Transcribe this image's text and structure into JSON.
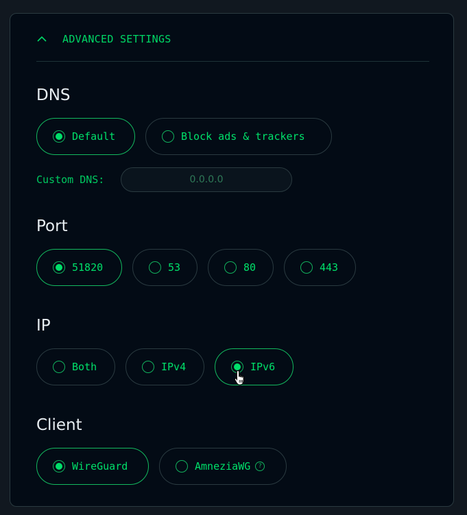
{
  "header": {
    "title": "ADVANCED SETTINGS",
    "toggle_icon": "chevron-up-icon"
  },
  "dns": {
    "title": "DNS",
    "options": [
      {
        "label": "Default",
        "selected": true
      },
      {
        "label": "Block ads & trackers",
        "selected": false
      }
    ],
    "custom_label": "Custom DNS:",
    "custom_placeholder": "0.0.0.0",
    "custom_value": ""
  },
  "port": {
    "title": "Port",
    "options": [
      {
        "label": "51820",
        "selected": true
      },
      {
        "label": "53",
        "selected": false
      },
      {
        "label": "80",
        "selected": false
      },
      {
        "label": "443",
        "selected": false
      }
    ]
  },
  "ip": {
    "title": "IP",
    "options": [
      {
        "label": "Both",
        "selected": false
      },
      {
        "label": "IPv4",
        "selected": false
      },
      {
        "label": "IPv6",
        "selected": true
      }
    ]
  },
  "client": {
    "title": "Client",
    "options": [
      {
        "label": "WireGuard",
        "selected": true
      },
      {
        "label": "AmneziaWG",
        "selected": false,
        "help": "?"
      }
    ]
  },
  "colors": {
    "accent": "#00e06a",
    "panel_bg": "#030b15",
    "border": "#2a3a40",
    "heading": "#e8eef2"
  }
}
